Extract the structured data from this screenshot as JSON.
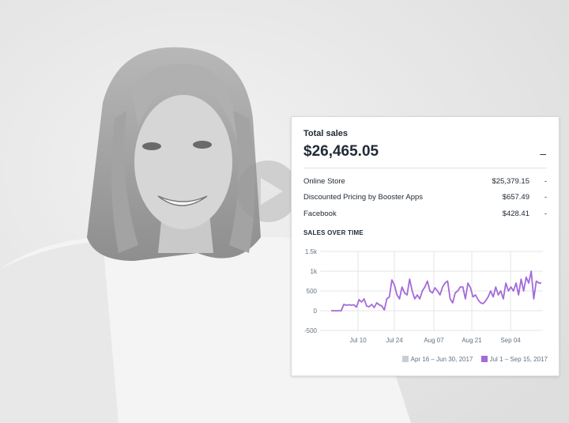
{
  "card": {
    "title": "Total sales",
    "total": "$26,465.05",
    "total_dash": "–",
    "rows": [
      {
        "label": "Online Store",
        "value": "$25,379.15",
        "dash": "-"
      },
      {
        "label": "Discounted Pricing by Booster Apps",
        "value": "$657.49",
        "dash": "-"
      },
      {
        "label": "Facebook",
        "value": "$428.41",
        "dash": "-"
      }
    ],
    "chart_title": "SALES OVER TIME"
  },
  "icons": {
    "play": "play-icon"
  },
  "colors": {
    "series": "#a36bd8",
    "compare": "#c9ced6",
    "grid": "#e6e6e6"
  },
  "chart_data": {
    "type": "line",
    "x_ticks": [
      "Jul 10",
      "Jul 24",
      "Aug 07",
      "Aug 21",
      "Sep 04"
    ],
    "y_ticks": [
      "1.5k",
      "1k",
      "500",
      "0",
      "-500"
    ],
    "ylim": [
      -500,
      1500
    ],
    "legend_position": "bottom-right",
    "series": [
      {
        "name": "Apr 16 – Jun 30, 2017",
        "values": []
      },
      {
        "name": "Jul 1 – Sep 15, 2017",
        "values": [
          0,
          0,
          0,
          0,
          0,
          160,
          140,
          150,
          140,
          150,
          90,
          280,
          220,
          300,
          120,
          100,
          160,
          80,
          200,
          150,
          120,
          20,
          300,
          350,
          780,
          650,
          400,
          300,
          600,
          450,
          400,
          800,
          500,
          300,
          400,
          300,
          500,
          600,
          750,
          500,
          450,
          580,
          500,
          400,
          600,
          700,
          750,
          300,
          200,
          450,
          500,
          600,
          600,
          300,
          700,
          580,
          350,
          400,
          280,
          200,
          180,
          250,
          350,
          500,
          350,
          600,
          400,
          500,
          300,
          700,
          500,
          600,
          500,
          700,
          400,
          800,
          500,
          850,
          700,
          1000,
          300,
          750,
          700,
          700
        ]
      }
    ]
  }
}
